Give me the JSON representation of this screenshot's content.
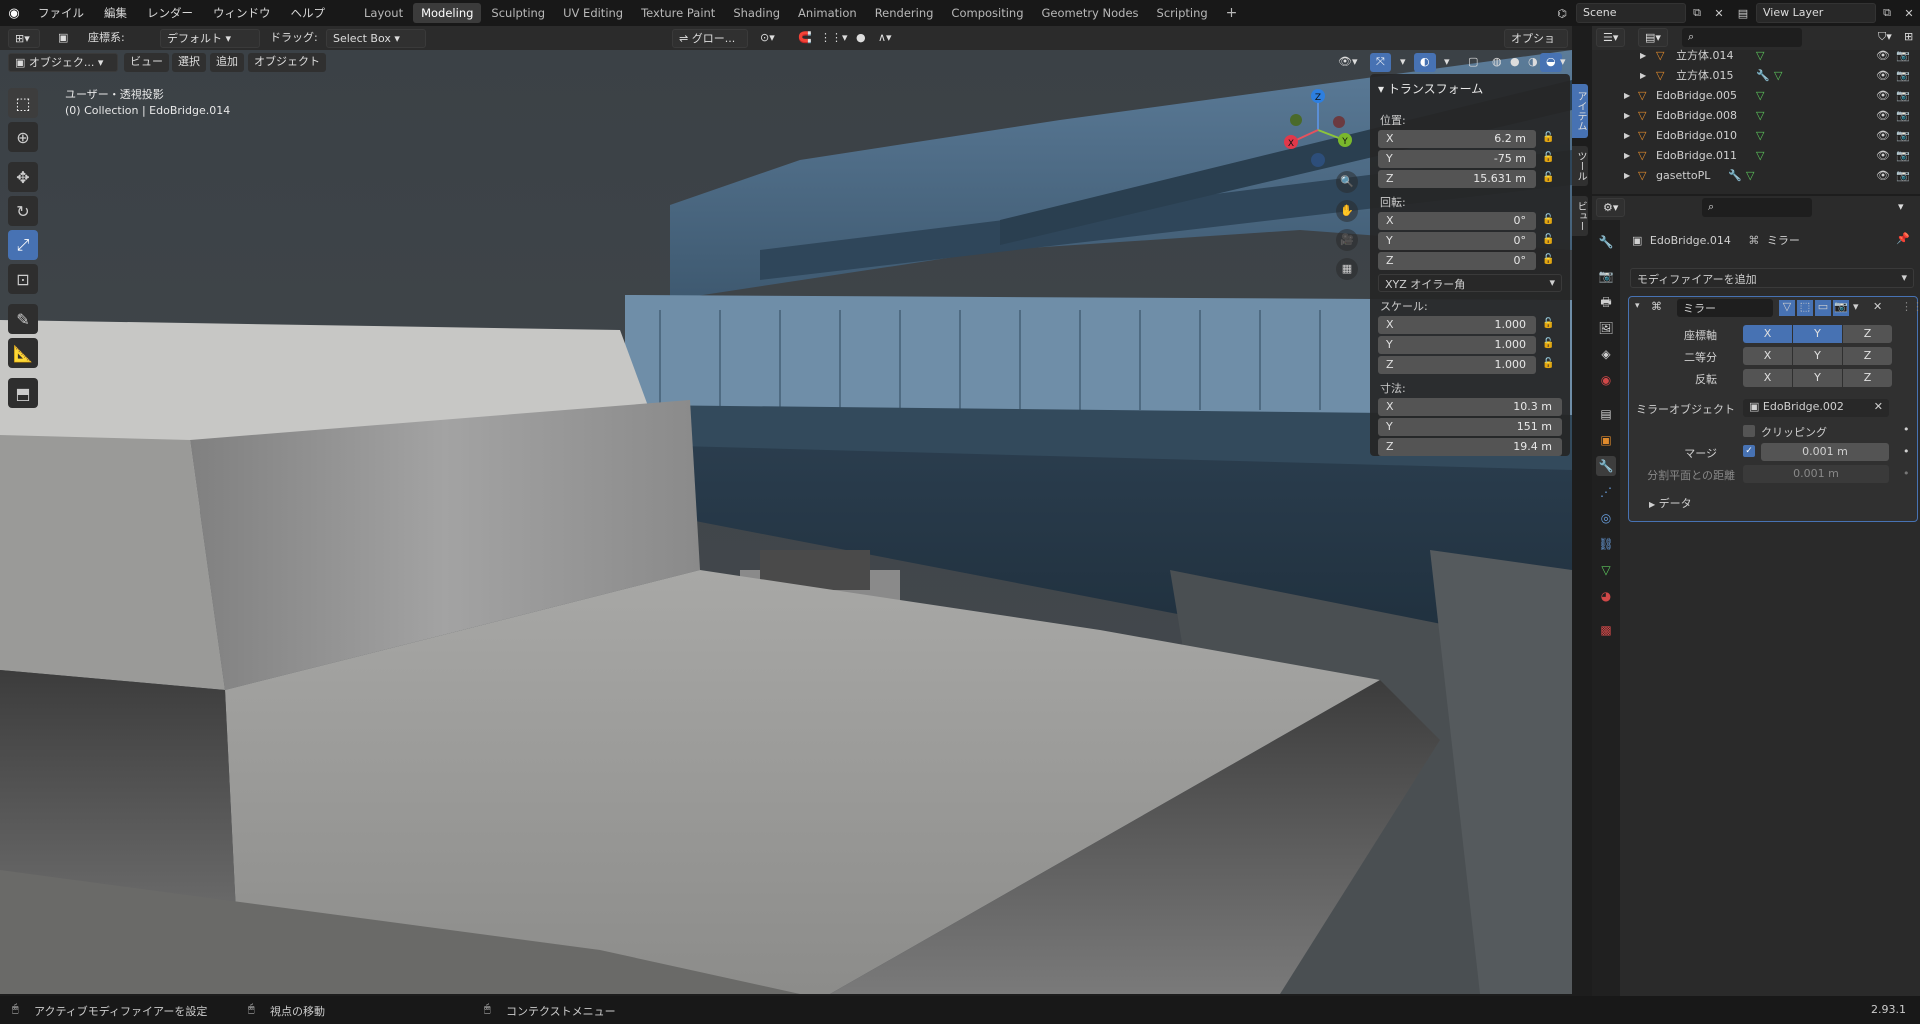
{
  "topbar": {
    "menus": [
      "ファイル",
      "編集",
      "レンダー",
      "ウィンドウ",
      "ヘルプ"
    ],
    "workspaces": [
      "Layout",
      "Modeling",
      "Sculpting",
      "UV Editing",
      "Texture Paint",
      "Shading",
      "Animation",
      "Rendering",
      "Compositing",
      "Geometry Nodes",
      "Scripting"
    ],
    "active_workspace": "Modeling",
    "add_tab": "+",
    "scene": "Scene",
    "view_layer": "View Layer"
  },
  "header": {
    "orientation_label": "座標系:",
    "orientation_value": "デフォルト",
    "drag_label": "ドラッグ:",
    "drag_value": "Select Box",
    "transform_orient": "グロー...",
    "options": "オプション"
  },
  "viewport_header": {
    "mode": "オブジェク...",
    "menus": [
      "ビュー",
      "選択",
      "追加",
      "オブジェクト"
    ]
  },
  "viewport": {
    "view_name": "ユーザー・透視投影",
    "collection": "(0) Collection | EdoBridge.014",
    "gizmo": {
      "x": "X",
      "y": "Y",
      "z": "Z"
    }
  },
  "npanel": {
    "title": "トランスフォーム",
    "location_label": "位置:",
    "location": [
      {
        "axis": "X",
        "value": "6.2 m"
      },
      {
        "axis": "Y",
        "value": "-75 m"
      },
      {
        "axis": "Z",
        "value": "15.631 m"
      }
    ],
    "rotation_label": "回転:",
    "rotation": [
      {
        "axis": "X",
        "value": "0°"
      },
      {
        "axis": "Y",
        "value": "0°"
      },
      {
        "axis": "Z",
        "value": "0°"
      }
    ],
    "rotation_mode": "XYZ オイラー角",
    "scale_label": "スケール:",
    "scale": [
      {
        "axis": "X",
        "value": "1.000"
      },
      {
        "axis": "Y",
        "value": "1.000"
      },
      {
        "axis": "Z",
        "value": "1.000"
      }
    ],
    "dimensions_label": "寸法:",
    "dimensions": [
      {
        "axis": "X",
        "value": "10.3 m"
      },
      {
        "axis": "Y",
        "value": "151 m"
      },
      {
        "axis": "Z",
        "value": "19.4 m"
      }
    ],
    "tabs": [
      "アイテム",
      "ツール",
      "ビュー"
    ]
  },
  "outliner": {
    "items": [
      {
        "name": "立方体.014",
        "indent": 2
      },
      {
        "name": "立方体.015",
        "indent": 2
      },
      {
        "name": "EdoBridge.005",
        "indent": 1
      },
      {
        "name": "EdoBridge.008",
        "indent": 1
      },
      {
        "name": "EdoBridge.010",
        "indent": 1
      },
      {
        "name": "EdoBridge.011",
        "indent": 1
      },
      {
        "name": "gasettoPL",
        "indent": 1
      }
    ]
  },
  "properties": {
    "object": "EdoBridge.014",
    "modifier_breadcrumb": "ミラー",
    "add_modifier": "モディファイアーを追加",
    "modifier_name": "ミラー",
    "axis_label": "座標軸",
    "bisect_label": "二等分",
    "flip_label": "反転",
    "axes": [
      "X",
      "Y",
      "Z"
    ],
    "mirror_object_label": "ミラーオブジェクト",
    "mirror_object": "EdoBridge.002",
    "clipping": "クリッピング",
    "merge_label": "マージ",
    "merge_value": "0.001 m",
    "bisect_distance_label": "分割平面との距離",
    "bisect_distance_value": "0.001 m",
    "data_label": "データ"
  },
  "status": {
    "left": "アクティブモディファイアーを設定",
    "middle": "視点の移動",
    "context": "コンテクストメニュー",
    "version": "2.93.1"
  },
  "colors": {
    "accent": "#4772b3",
    "outliner_mesh": "#e08a2c",
    "viewport_bg": "#3a3f43"
  }
}
